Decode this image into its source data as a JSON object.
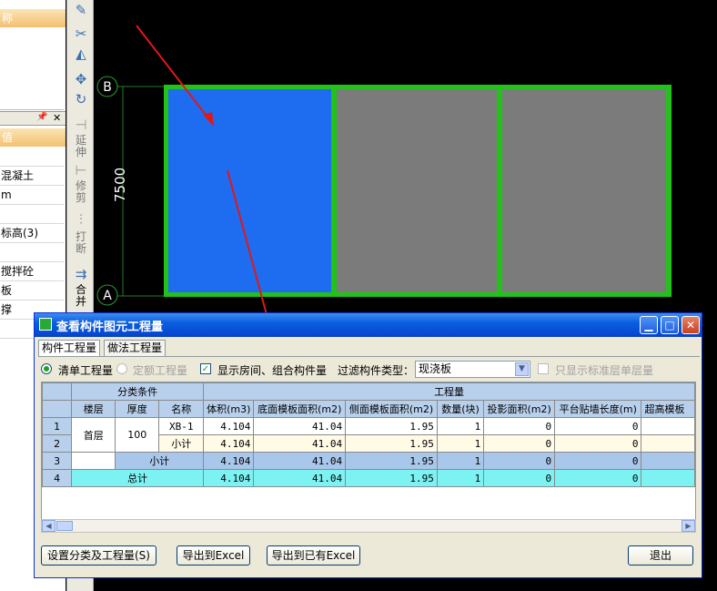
{
  "left_panel": {
    "header_top": "称",
    "header_mid": "值",
    "rows": [
      "",
      "混凝土",
      "m",
      "",
      "标高(3)",
      "",
      "搅拌砼",
      "板",
      "撑",
      ""
    ],
    "bar_icons": [
      "📌",
      "✕"
    ]
  },
  "vtoolbar": {
    "texts": [
      "延伸",
      "修剪",
      "打断",
      "合并"
    ]
  },
  "canvas": {
    "axis_b": "B",
    "axis_a": "A",
    "dim_label": "7500",
    "colors": {
      "slab_selected": "#1e6df0",
      "slab": "#7b7b7b",
      "beam": "#22c21a",
      "arrow": "#e01818"
    }
  },
  "dialog": {
    "title": "查看构件图元工程量",
    "tabs": [
      "构件工程量",
      "做法工程量"
    ],
    "radio_list": "清单工程量",
    "radio_quota": "定额工程量",
    "check_show": "显示房间、组合构件量",
    "filter_label": "过滤构件类型：",
    "filter_value": "现浇板",
    "check_std": "只显示标准层单层量",
    "grid": {
      "group_class": "分类条件",
      "group_qty": "工程量",
      "col_floor": "楼层",
      "col_thick": "厚度",
      "col_name": "名称",
      "col_vol": "体积(m3)",
      "col_bottom": "底面模板面积(m2)",
      "col_side": "侧面模板面积(m2)",
      "col_count": "数量(块)",
      "col_proj": "投影面积(m2)",
      "col_wall": "平台贴墙长度(m)",
      "col_over": "超高模板",
      "row_nums": [
        "1",
        "2",
        "3",
        "4"
      ],
      "floor": "首层",
      "thick": "100",
      "name1": "XB-1",
      "subtotal": "小计",
      "total": "总计",
      "vol": "4.104",
      "bottom": "41.04",
      "side": "1.95",
      "count": "1",
      "proj": "0",
      "wall": "0"
    },
    "btn_setup": "设置分类及工程量(S)",
    "btn_export": "导出到Excel",
    "btn_export_existing": "导出到已有Excel",
    "btn_exit": "退出"
  }
}
